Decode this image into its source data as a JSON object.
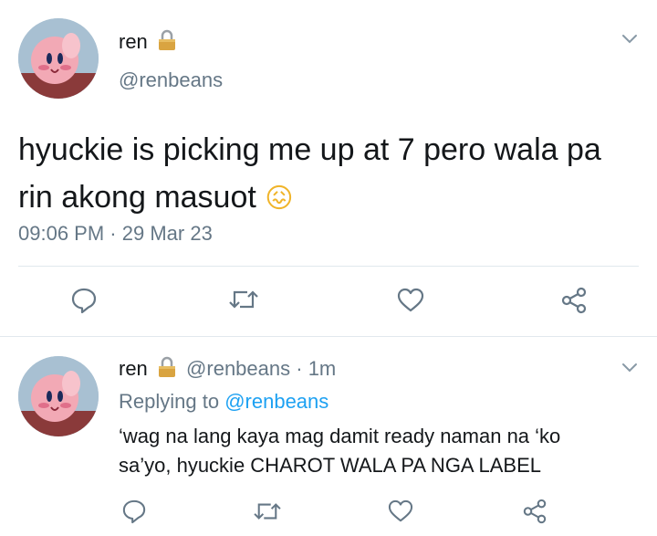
{
  "tweet": {
    "author_name": "ren",
    "author_handle": "@renbeans",
    "text": "hyuckie is picking me up at 7 pero wala pa rin akong masuot",
    "emoji": "😖",
    "timestamp": "09:06 PM",
    "separator": "·",
    "date": "29 Mar 23"
  },
  "reply": {
    "author_name": "ren",
    "author_handle": "@renbeans",
    "time": "· 1m",
    "replying_label": "Replying to",
    "replying_handle": "@renbeans",
    "text_line1": "‘wag na lang kaya mag damit ready naman na ‘ko",
    "text_line2": "sa’yo, hyuckie CHAROT WALA PA NGA LABEL"
  },
  "icons": {
    "lock": "lock-icon",
    "chevron": "chevron-down-icon",
    "reply": "reply-icon",
    "retweet": "retweet-icon",
    "like": "heart-icon",
    "share": "share-icon"
  },
  "colors": {
    "text": "#14171a",
    "muted": "#657786",
    "link": "#1da1f2",
    "divider": "#e1e8ed"
  }
}
